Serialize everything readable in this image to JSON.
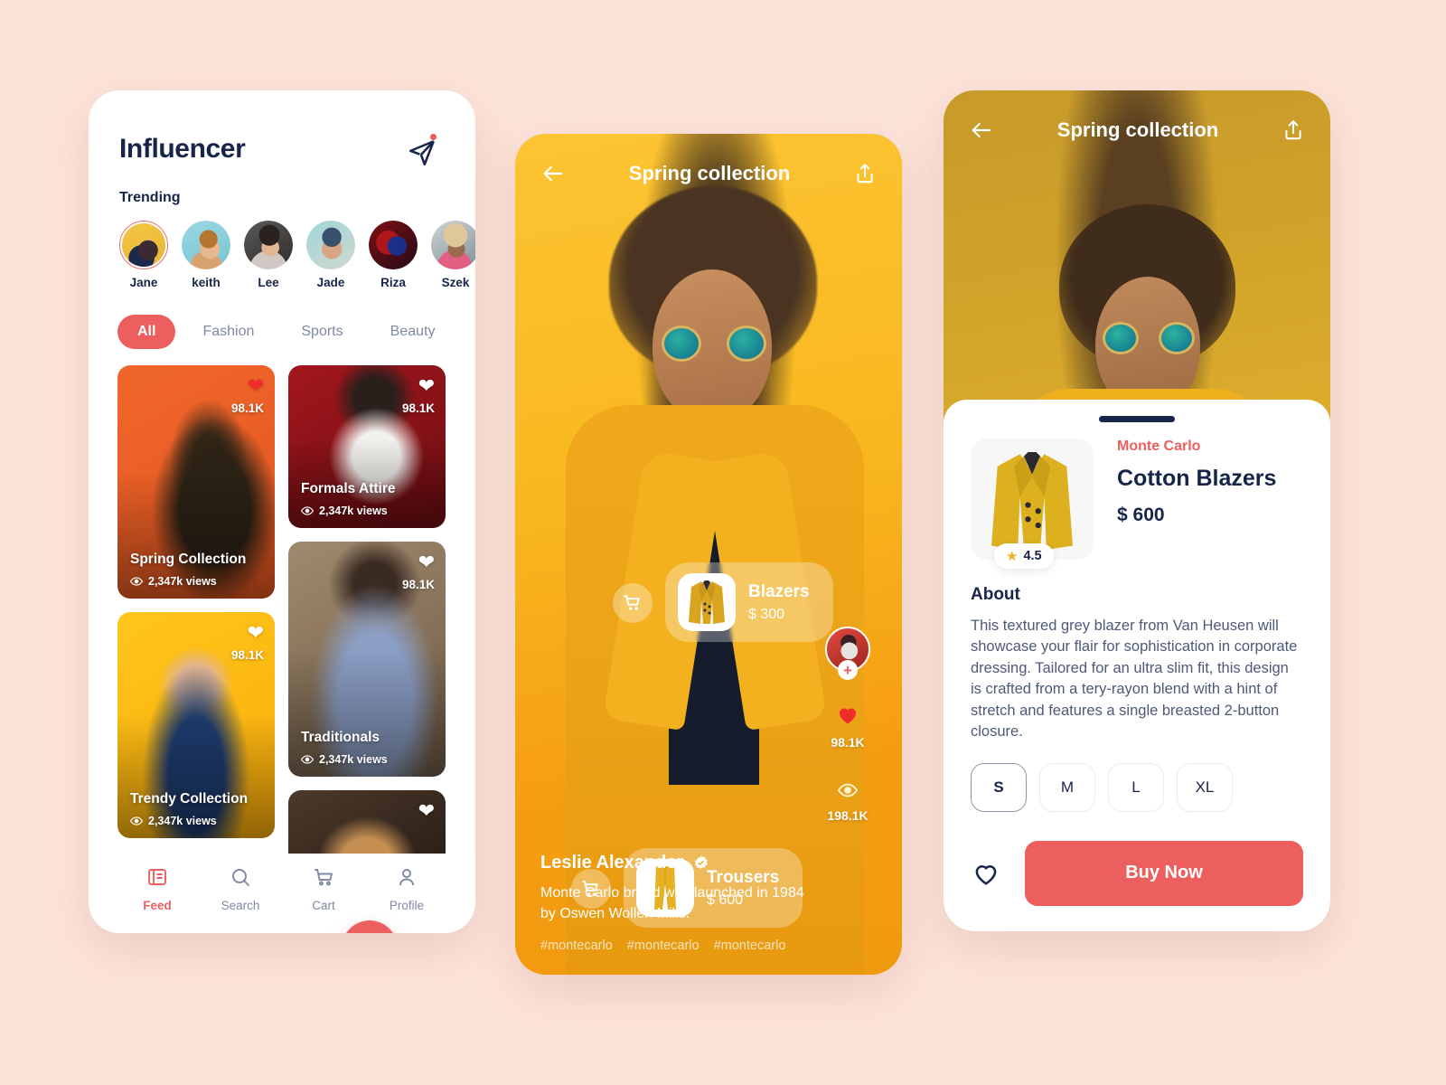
{
  "theme": {
    "page_bg": "#fce3da",
    "accent_red": "#ec5f5e",
    "ink": "#17254b",
    "muted": "#7e8aa2",
    "amber": "#f9b81f"
  },
  "left_screen": {
    "title": "Influencer",
    "send_icon": "send-icon",
    "section_label": "Trending",
    "avatars": [
      {
        "name": "Jane",
        "selected": true
      },
      {
        "name": "keith",
        "selected": false
      },
      {
        "name": "Lee",
        "selected": false
      },
      {
        "name": "Jade",
        "selected": false
      },
      {
        "name": "Riza",
        "selected": false
      },
      {
        "name": "Szek",
        "selected": false
      }
    ],
    "filters": [
      {
        "label": "All",
        "active": true
      },
      {
        "label": "Fashion",
        "active": false
      },
      {
        "label": "Sports",
        "active": false
      },
      {
        "label": "Beauty",
        "active": false
      }
    ],
    "cards": [
      {
        "title": "Spring Collection",
        "views": "2,347k views",
        "likes": "98.1K",
        "liked": true
      },
      {
        "title": "Formals Attire",
        "views": "2,347k views",
        "likes": "98.1K",
        "liked": false
      },
      {
        "title": "Traditionals",
        "views": "2,347k views",
        "likes": "98.1K",
        "liked": false
      },
      {
        "title": "Trendy Collection",
        "views": "2,347k views",
        "likes": "98.1K",
        "liked": false
      },
      {
        "title": "",
        "views": "",
        "likes": "",
        "liked": false
      }
    ],
    "scan_button": "scan-icon",
    "tabs": [
      {
        "label": "Feed",
        "icon": "feed-icon",
        "active": true
      },
      {
        "label": "Search",
        "icon": "search-icon",
        "active": false
      },
      {
        "label": "Cart",
        "icon": "cart-icon",
        "active": false
      },
      {
        "label": "Profile",
        "icon": "profile-icon",
        "active": false
      }
    ]
  },
  "middle_screen": {
    "back_icon": "arrow-left-icon",
    "title": "Spring collection",
    "share_icon": "share-icon",
    "product_tags": [
      {
        "name": "Blazers",
        "price": "$ 300",
        "thumb": "blazer-thumb"
      },
      {
        "name": "Trousers",
        "price": "$ 600",
        "thumb": "trousers-thumb"
      }
    ],
    "rail": {
      "follow_label": "+",
      "likes": "98.1K",
      "views": "198.1K"
    },
    "author": "Leslie Alexander",
    "verified": true,
    "description": "Monte Carlo brand was launched in 1984 by Oswen Wollen Mills.",
    "hashtags": [
      "#montecarlo",
      "#montecarlo",
      "#montecarlo"
    ]
  },
  "right_screen": {
    "back_icon": "arrow-left-icon",
    "title": "Spring collection",
    "share_icon": "share-icon",
    "rating": "4.5",
    "brand": "Monte Carlo",
    "product_name": "Cotton Blazers",
    "price": "$ 600",
    "about_heading": "About",
    "about_text": "This textured grey blazer from Van Heusen will showcase your flair for sophistication in corporate dressing. Tailored for an ultra slim fit, this design is crafted from a tery-rayon blend with a hint of stretch and features a single breasted 2-button closure.",
    "sizes": [
      {
        "label": "S",
        "selected": true
      },
      {
        "label": "M",
        "selected": false
      },
      {
        "label": "L",
        "selected": false
      },
      {
        "label": "XL",
        "selected": false
      }
    ],
    "wishlist_icon": "heart-outline-icon",
    "buy_label": "Buy Now"
  }
}
